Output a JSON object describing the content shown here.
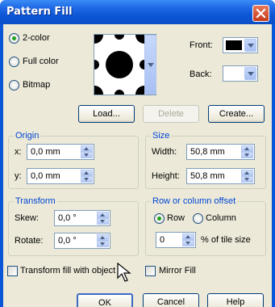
{
  "window": {
    "title": "Pattern Fill"
  },
  "pattern_type": {
    "options": [
      {
        "label": "2-color",
        "selected": true
      },
      {
        "label": "Full color",
        "selected": false
      },
      {
        "label": "Bitmap",
        "selected": false
      }
    ]
  },
  "colors": {
    "front_label": "Front:",
    "back_label": "Back:",
    "front_color": "#000000",
    "back_color": "#ffffff"
  },
  "pattern_buttons": {
    "load": "Load...",
    "delete": "Delete",
    "create": "Create..."
  },
  "origin": {
    "title": "Origin",
    "x_label": "x:",
    "x_value": "0,0 mm",
    "y_label": "y:",
    "y_value": "0,0 mm"
  },
  "size": {
    "title": "Size",
    "width_label": "Width:",
    "width_value": "50,8 mm",
    "height_label": "Height:",
    "height_value": "50,8 mm"
  },
  "transform": {
    "title": "Transform",
    "skew_label": "Skew:",
    "skew_value": "0,0 °",
    "rotate_label": "Rotate:",
    "rotate_value": "0,0 °"
  },
  "offset": {
    "title": "Row or column offset",
    "row_label": "Row",
    "column_label": "Column",
    "row_selected": true,
    "value": "0",
    "unit_label": "% of tile size"
  },
  "options": {
    "transform_fill": "Transform fill with object",
    "mirror_fill": "Mirror Fill"
  },
  "footer": {
    "ok": "OK",
    "cancel": "Cancel",
    "help": "Help"
  }
}
